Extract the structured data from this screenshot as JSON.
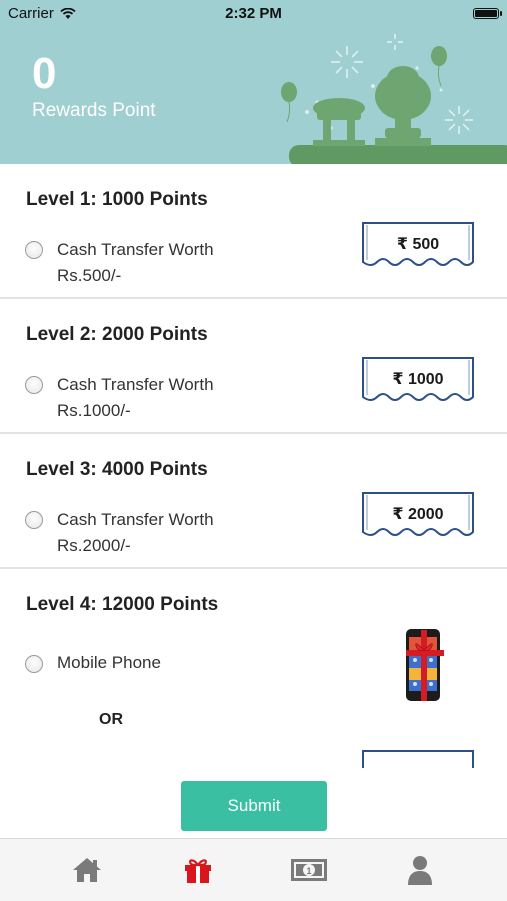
{
  "status_bar": {
    "carrier": "Carrier",
    "time": "2:32 PM"
  },
  "header": {
    "points": "0",
    "points_label": "Rewards Point"
  },
  "levels": [
    {
      "title": "Level 1: 1000 Points",
      "desc_line1": "Cash Transfer Worth",
      "desc_line2": "Rs.500/-",
      "voucher": "₹ 500"
    },
    {
      "title": "Level 2: 2000 Points",
      "desc_line1": "Cash Transfer Worth",
      "desc_line2": "Rs.1000/-",
      "voucher": "₹ 1000"
    },
    {
      "title": "Level 3: 4000 Points",
      "desc_line1": "Cash Transfer Worth",
      "desc_line2": "Rs.2000/-",
      "voucher": "₹ 2000"
    },
    {
      "title": "Level 4: 12000 Points",
      "desc_line1": "Mobile Phone",
      "or_label": "OR"
    }
  ],
  "submit_label": "Submit",
  "tabs": [
    {
      "name": "home-icon",
      "active": false
    },
    {
      "name": "gift-icon",
      "active": true
    },
    {
      "name": "cash-icon",
      "active": false
    },
    {
      "name": "profile-icon",
      "active": false
    }
  ],
  "colors": {
    "banner": "#9fcfd0",
    "submit": "#3bbfa3",
    "tab_active": "#d9161c",
    "tab_inactive": "#7a7a7a",
    "voucher_border": "#2c4f8c"
  }
}
